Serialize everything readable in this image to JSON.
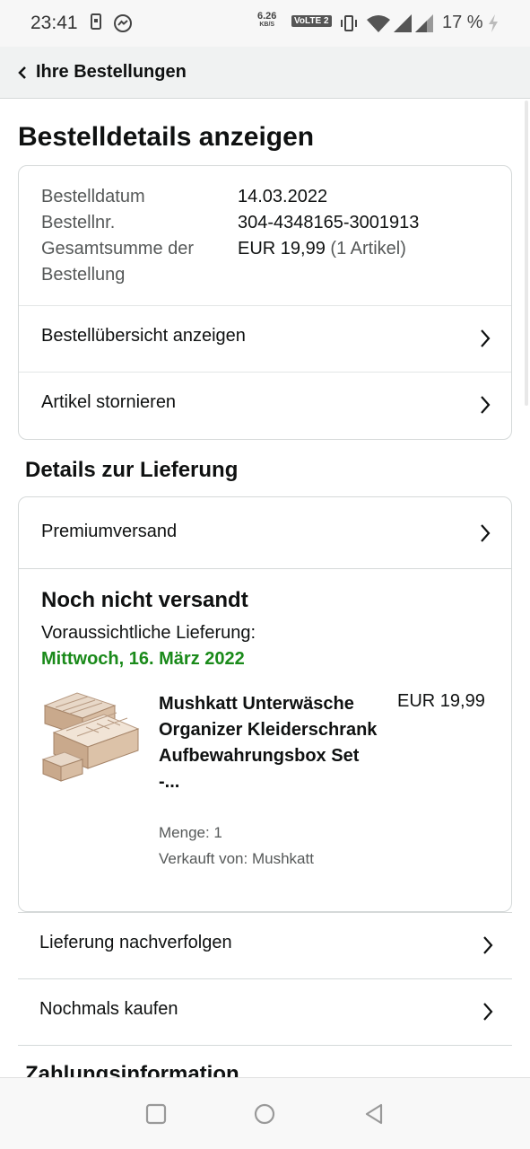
{
  "status_bar": {
    "time": "23:41",
    "net_speed": "6.26",
    "net_unit": "KB/S",
    "volte": "VoLTE 2",
    "battery": "17 %"
  },
  "header": {
    "back_label": "Ihre Bestellungen"
  },
  "page_title": "Bestelldetails anzeigen",
  "summary": {
    "order_date_label": "Bestelldatum",
    "order_date": "14.03.2022",
    "order_no_label": "Bestellnr.",
    "order_no": "304-4348165-3001913",
    "total_label": "Gesamtsumme der Bestellung",
    "total_value": "EUR 19,99",
    "total_count": "(1 Artikel)",
    "link_overview": "Bestellübersicht anzeigen",
    "link_cancel": "Artikel stornieren"
  },
  "delivery": {
    "section_title": "Details zur Lieferung",
    "shipping_method": "Premiumversand",
    "status": "Noch nicht versandt",
    "eta_label": "Voraussichtliche Lieferung:",
    "eta_date": "Mittwoch, 16. März 2022",
    "product": {
      "title": "Mushkatt Unterwäsche Organizer Kleiderschrank Aufbewahrungsbox Set -...",
      "price": "EUR 19,99",
      "quantity": "Menge: 1",
      "seller": "Verkauft von: Mushkatt"
    },
    "link_track": "Lieferung nachverfolgen",
    "link_rebuy": "Nochmals kaufen"
  },
  "payment_title": "Zahlungsinformation",
  "colors": {
    "accent_green": "#1a8a1a",
    "border": "#d5d9d9"
  }
}
